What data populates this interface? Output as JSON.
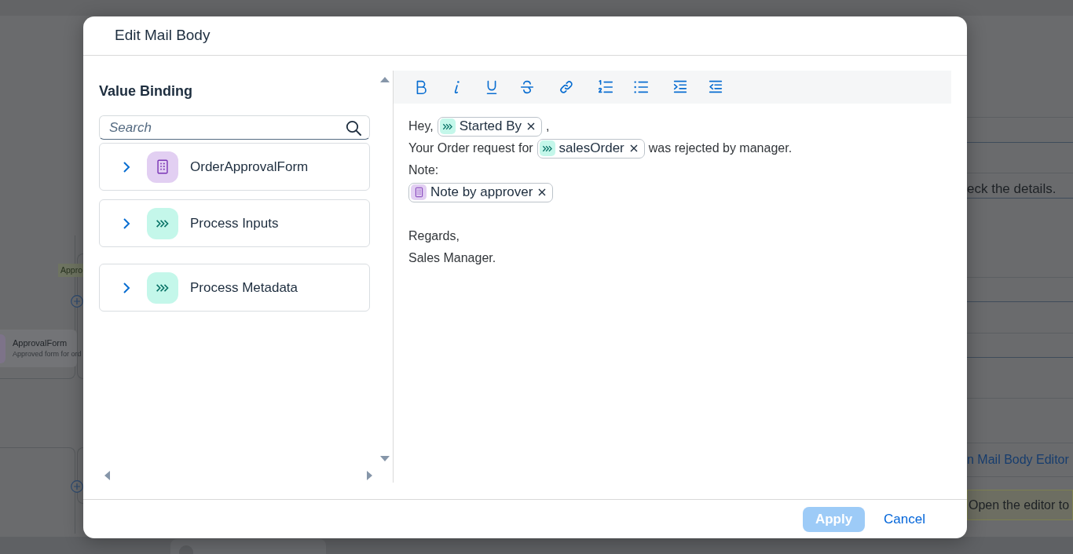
{
  "background_canvas": {
    "lane_label": "Appro",
    "node": {
      "title": "ApprovalForm",
      "subtitle": "Approved form for ord"
    }
  },
  "background_panel": {
    "items": [
      {
        "kind": "text",
        "text": "eck the details."
      },
      {
        "kind": "link",
        "text": "n Mail Body Editor"
      },
      {
        "kind": "message",
        "text": "Open the editor to"
      }
    ]
  },
  "dialog": {
    "title": "Edit Mail Body",
    "value_binding": {
      "heading": "Value Binding",
      "search": {
        "placeholder": "Search"
      },
      "items": [
        {
          "label": "OrderApprovalForm",
          "kind": "form",
          "expanded": false
        },
        {
          "label": "Process Inputs",
          "kind": "input",
          "expanded": false
        },
        {
          "label": "Process Metadata",
          "kind": "input",
          "expanded": false
        }
      ]
    },
    "editor": {
      "paragraphs": [
        {
          "lines": [
            {
              "segments": [
                {
                  "kind": "text",
                  "text": "Hey,"
                },
                {
                  "kind": "input",
                  "text": "Started By"
                },
                {
                  "kind": "text",
                  "text": ","
                }
              ]
            },
            {
              "segments": [
                {
                  "kind": "text",
                  "text": "Your Order request for"
                },
                {
                  "kind": "input",
                  "text": "salesOrder"
                },
                {
                  "kind": "text",
                  "text": "was rejected by manager."
                }
              ]
            },
            {
              "segments": [
                {
                  "kind": "text",
                  "text": "Note:"
                }
              ]
            },
            {
              "segments": [
                {
                  "kind": "form",
                  "text": "Note by approver"
                }
              ]
            }
          ]
        },
        {
          "lines": [
            {
              "segments": [
                {
                  "kind": "text",
                  "text": "Regards,"
                }
              ]
            },
            {
              "segments": [
                {
                  "kind": "text",
                  "text": "Sales Manager."
                }
              ]
            }
          ]
        }
      ]
    },
    "buttons": [
      {
        "label": "Apply",
        "kind": "emphasized",
        "disabled": true
      },
      {
        "label": "Cancel",
        "kind": "transparent",
        "disabled": false
      }
    ]
  }
}
